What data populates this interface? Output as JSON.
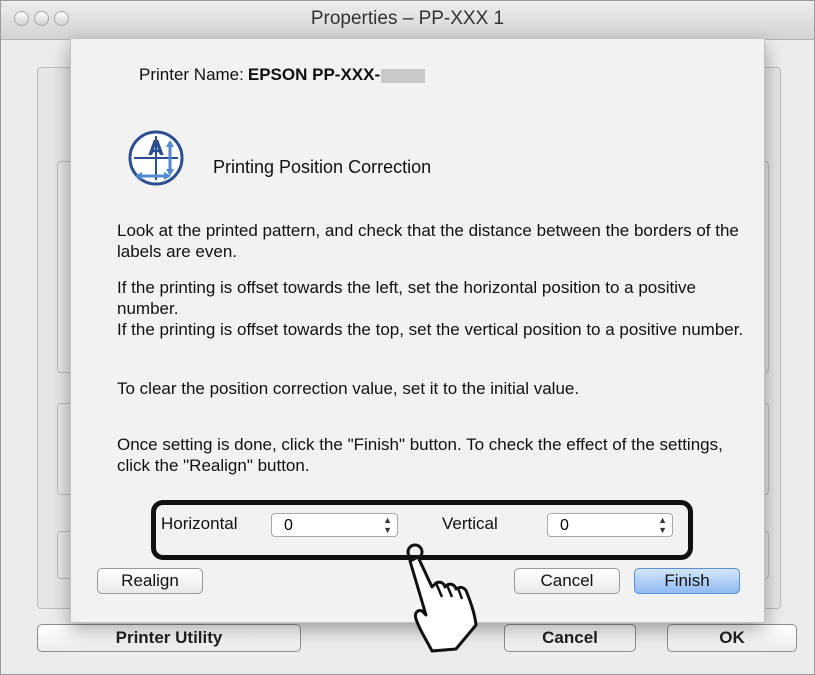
{
  "window": {
    "title": "Properties – PP-XXX 1"
  },
  "sheet": {
    "printer_name_label": "Printer Name:",
    "printer_name_value": "EPSON PP-XXX-",
    "feature_title": "Printing Position Correction",
    "instructions": {
      "p1": "Look at the printed pattern, and check that the distance between the borders of the labels are even.",
      "p2": "If the printing is offset towards the left, set the horizontal position to a positive number.",
      "p3": "If the printing is offset towards the top, set the vertical position to a positive number.",
      "p4": "To clear the position correction value, set it to the initial value.",
      "p5": "Once setting is done, click the \"Finish\" button. To check the effect of the settings, click the \"Realign\" button."
    },
    "horizontal": {
      "label": "Horizontal",
      "value": "0"
    },
    "vertical": {
      "label": "Vertical",
      "value": "0"
    },
    "buttons": {
      "realign": "Realign",
      "cancel": "Cancel",
      "finish": "Finish"
    }
  },
  "bottom_bar": {
    "printer_utility": "Printer Utility",
    "cancel": "Cancel",
    "ok": "OK"
  }
}
